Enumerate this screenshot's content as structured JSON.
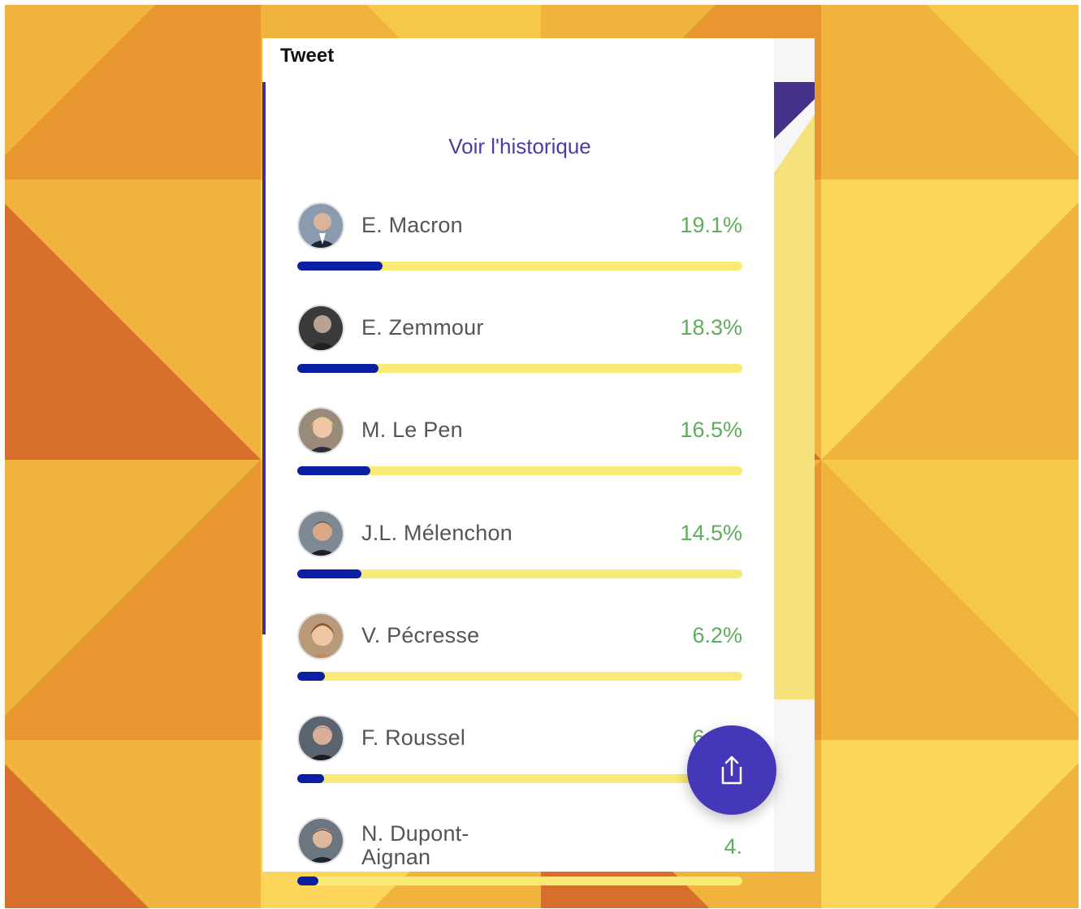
{
  "header": {
    "title": "Tweet"
  },
  "history_link": "Voir l'historique",
  "colors": {
    "accent": "#4538b8",
    "bar_fill": "#0b1fa3",
    "bar_track": "#f8ea76",
    "percent_text": "#5fae5c"
  },
  "candidates": [
    {
      "name": "E. Macron",
      "percent_label": "19.1%",
      "percent": 19.1,
      "avatar_icon": "person-avatar-icon"
    },
    {
      "name": "E. Zemmour",
      "percent_label": "18.3%",
      "percent": 18.3,
      "avatar_icon": "person-avatar-icon"
    },
    {
      "name": "M. Le Pen",
      "percent_label": "16.5%",
      "percent": 16.5,
      "avatar_icon": "person-avatar-icon"
    },
    {
      "name": "J.L. Mélenchon",
      "percent_label": "14.5%",
      "percent": 14.5,
      "avatar_icon": "person-avatar-icon"
    },
    {
      "name": "V. Pécresse",
      "percent_label": "6.2%",
      "percent": 6.2,
      "avatar_icon": "person-avatar-icon"
    },
    {
      "name": "F. Roussel",
      "percent_label": "6.1%",
      "percent": 6.1,
      "avatar_icon": "person-avatar-icon"
    },
    {
      "name_line1": "N. Dupont-",
      "name_line2": "Aignan",
      "percent_label": "4.",
      "percent": 4.7,
      "avatar_icon": "person-avatar-icon"
    }
  ],
  "fab": {
    "icon": "share-icon"
  }
}
